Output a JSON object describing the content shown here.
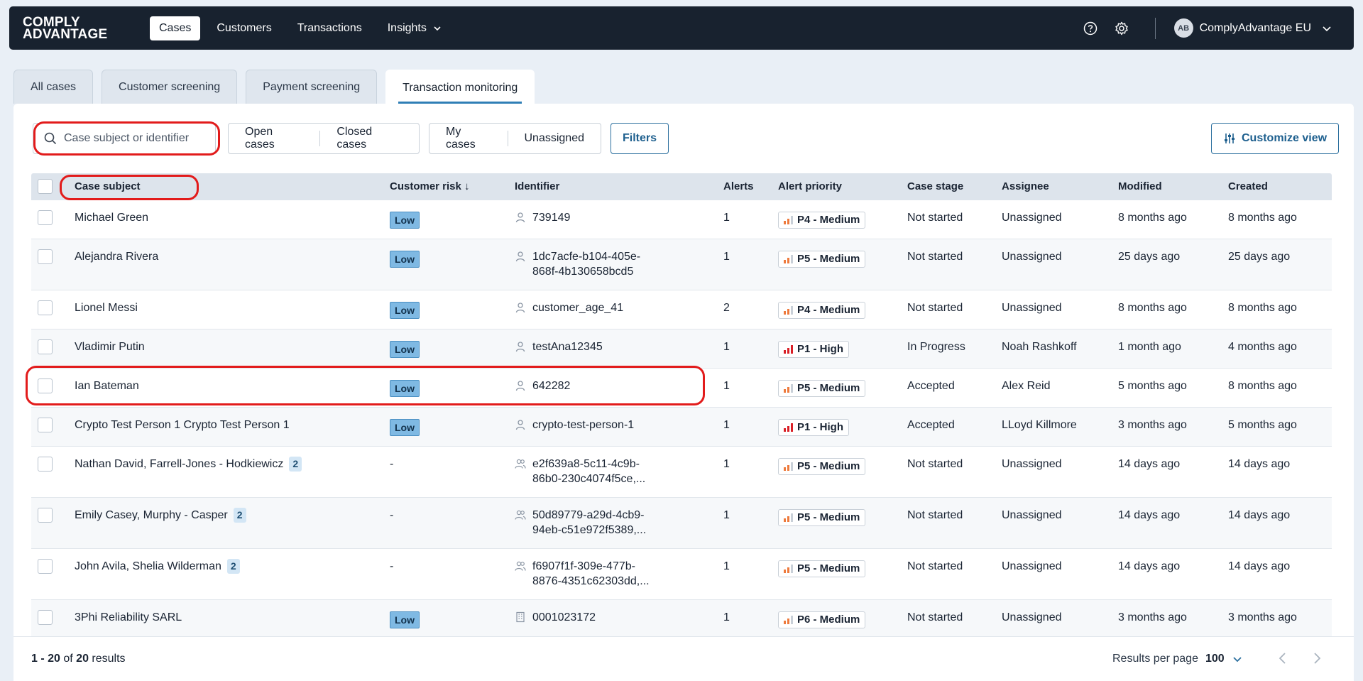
{
  "nav": {
    "logo_line1": "COMPLY",
    "logo_line2": "ADVANTAGE",
    "links": [
      "Cases",
      "Customers",
      "Transactions",
      "Insights"
    ],
    "avatar_initials": "AB",
    "org_name": "ComplyAdvantage EU"
  },
  "tabs": [
    "All cases",
    "Customer screening",
    "Payment screening",
    "Transaction monitoring"
  ],
  "toolbar": {
    "search_placeholder": "Case subject or identifier",
    "status_filters": [
      "Open cases",
      "Closed cases"
    ],
    "assign_filters": [
      "My cases",
      "Unassigned"
    ],
    "filters_label": "Filters",
    "customize_label": "Customize view"
  },
  "table": {
    "headers": {
      "subject": "Case subject",
      "risk": "Customer risk ↓",
      "identifier": "Identifier",
      "alerts": "Alerts",
      "priority": "Alert priority",
      "stage": "Case stage",
      "assignee": "Assignee",
      "modified": "Modified",
      "created": "Created"
    },
    "rows": [
      {
        "subject": "Michael Green",
        "count": "",
        "risk": "Low",
        "id_type": "person",
        "id1": "739149",
        "id2": "",
        "alerts": "1",
        "priority": "P4 - Medium",
        "level": "medium",
        "stage": "Not started",
        "assignee": "Unassigned",
        "modified": "8 months ago",
        "created": "8 months ago"
      },
      {
        "subject": "Alejandra Rivera",
        "count": "",
        "risk": "Low",
        "id_type": "person",
        "id1": "1dc7acfe-b104-405e-",
        "id2": "868f-4b130658bcd5",
        "alerts": "1",
        "priority": "P5 - Medium",
        "level": "medium",
        "stage": "Not started",
        "assignee": "Unassigned",
        "modified": "25 days ago",
        "created": "25 days ago"
      },
      {
        "subject": "Lionel Messi",
        "count": "",
        "risk": "Low",
        "id_type": "person",
        "id1": "customer_age_41",
        "id2": "",
        "alerts": "2",
        "priority": "P4 - Medium",
        "level": "medium",
        "stage": "Not started",
        "assignee": "Unassigned",
        "modified": "8 months ago",
        "created": "8 months ago"
      },
      {
        "subject": "Vladimir Putin",
        "count": "",
        "risk": "Low",
        "id_type": "person",
        "id1": "testAna12345",
        "id2": "",
        "alerts": "1",
        "priority": "P1 - High",
        "level": "high",
        "stage": "In Progress",
        "assignee": "Noah Rashkoff",
        "modified": "1 month ago",
        "created": "4 months ago"
      },
      {
        "subject": "Ian Bateman",
        "count": "",
        "risk": "Low",
        "id_type": "person",
        "id1": "642282",
        "id2": "",
        "alerts": "1",
        "priority": "P5 - Medium",
        "level": "medium",
        "stage": "Accepted",
        "assignee": "Alex Reid",
        "modified": "5 months ago",
        "created": "8 months ago"
      },
      {
        "subject": "Crypto Test Person 1 Crypto Test Person 1",
        "count": "",
        "risk": "Low",
        "id_type": "person",
        "id1": "crypto-test-person-1",
        "id2": "",
        "alerts": "1",
        "priority": "P1 - High",
        "level": "high",
        "stage": "Accepted",
        "assignee": "LLoyd Killmore",
        "modified": "3 months ago",
        "created": "5 months ago"
      },
      {
        "subject": "Nathan David, Farrell-Jones - Hodkiewicz",
        "count": "2",
        "risk": "-",
        "id_type": "group",
        "id1": "e2f639a8-5c11-4c9b-",
        "id2": "86b0-230c4074f5ce,...",
        "alerts": "1",
        "priority": "P5 - Medium",
        "level": "medium",
        "stage": "Not started",
        "assignee": "Unassigned",
        "modified": "14 days ago",
        "created": "14 days ago"
      },
      {
        "subject": "Emily Casey, Murphy - Casper",
        "count": "2",
        "risk": "-",
        "id_type": "group",
        "id1": "50d89779-a29d-4cb9-",
        "id2": "94eb-c51e972f5389,...",
        "alerts": "1",
        "priority": "P5 - Medium",
        "level": "medium",
        "stage": "Not started",
        "assignee": "Unassigned",
        "modified": "14 days ago",
        "created": "14 days ago"
      },
      {
        "subject": "John Avila, Shelia Wilderman",
        "count": "2",
        "risk": "-",
        "id_type": "group",
        "id1": "f6907f1f-309e-477b-",
        "id2": "8876-4351c62303dd,...",
        "alerts": "1",
        "priority": "P5 - Medium",
        "level": "medium",
        "stage": "Not started",
        "assignee": "Unassigned",
        "modified": "14 days ago",
        "created": "14 days ago"
      },
      {
        "subject": "3Phi Reliability SARL",
        "count": "",
        "risk": "Low",
        "id_type": "company",
        "id1": "0001023172",
        "id2": "",
        "alerts": "1",
        "priority": "P6 - Medium",
        "level": "medium",
        "stage": "Not started",
        "assignee": "Unassigned",
        "modified": "3 months ago",
        "created": "3 months ago"
      }
    ]
  },
  "footer": {
    "range": "1 - 20",
    "of": "of",
    "total": "20",
    "results_word": "results",
    "rpp_label": "Results per page",
    "rpp_value": "100"
  }
}
